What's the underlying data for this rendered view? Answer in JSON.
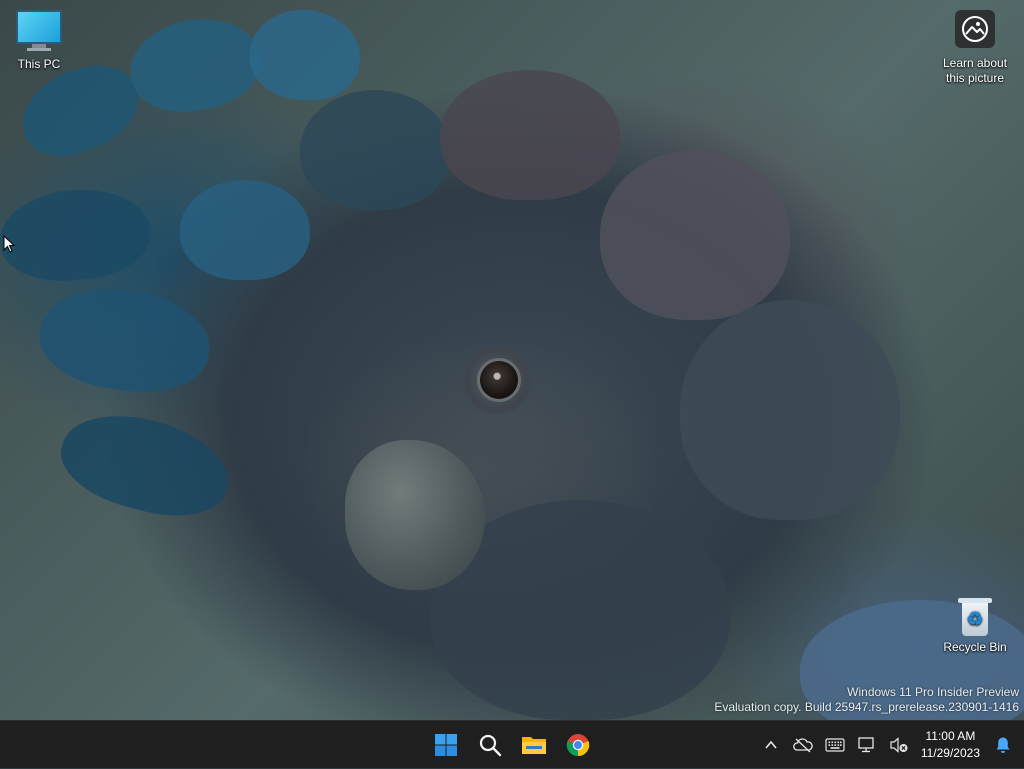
{
  "desktop": {
    "icons": [
      {
        "label": "This PC"
      },
      {
        "label": "Learn about this picture"
      },
      {
        "label": "Recycle Bin"
      }
    ],
    "watermark": {
      "line1": "Windows 11 Pro Insider Preview",
      "line2": "Evaluation copy. Build 25947.rs_prerelease.230901-1416"
    },
    "wallpaper_subject": "cockatoo-photo"
  },
  "taskbar": {
    "apps": [
      {
        "icon": "windows-start-icon"
      },
      {
        "icon": "search-icon"
      },
      {
        "icon": "file-explorer-icon"
      },
      {
        "icon": "chrome-icon"
      }
    ],
    "tray": {
      "icons": [
        "chevron-up-icon",
        "onedrive-offline-icon",
        "keyboard-icon",
        "network-icon",
        "speaker-muted-icon",
        "notification-bell-icon"
      ]
    },
    "clock": {
      "time": "11:00 AM",
      "date": "11/29/2023"
    }
  },
  "colors": {
    "taskbar_bg": "#1f1f1f",
    "accent_blue": "#1e88d8"
  }
}
